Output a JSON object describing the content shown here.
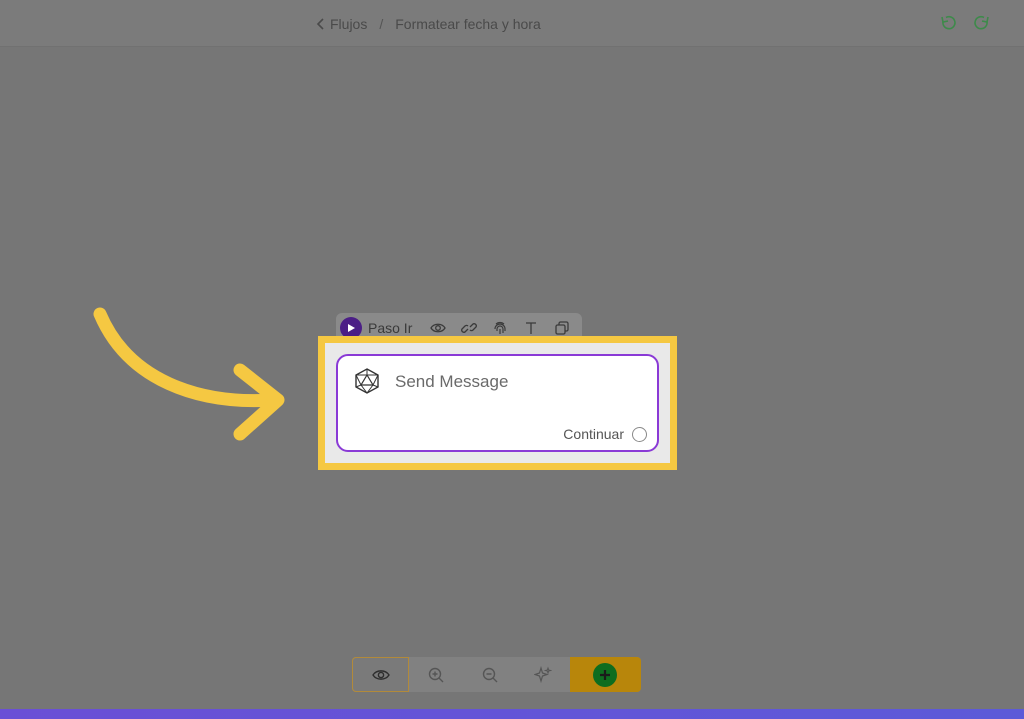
{
  "header": {
    "back_label": "Flujos",
    "separator": "/",
    "current": "Formatear fecha y hora",
    "undo_icon": "undo-icon",
    "redo_icon": "redo-icon"
  },
  "node": {
    "step_label": "Paso Ir",
    "title": "Send Message",
    "output_label": "Continuar",
    "toolbar_icons": [
      "eye-icon",
      "link-icon",
      "fingerprint-icon",
      "text-icon",
      "copy-icon"
    ]
  },
  "bottom_toolbar": {
    "icons": [
      "eye-icon",
      "zoom-in-icon",
      "zoom-out-icon",
      "sparkles-icon",
      "plus-icon"
    ]
  },
  "colors": {
    "highlight": "#f5c842",
    "node_border": "#8a3ad6",
    "play_bg": "#4b1e86",
    "add_bg": "#b8860b",
    "add_circle": "#0e6d1f"
  }
}
